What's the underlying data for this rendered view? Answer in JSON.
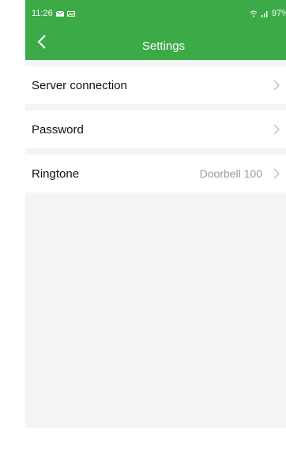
{
  "status_bar": {
    "time": "11:26",
    "icons_left": [
      "mail-icon",
      "gallery-icon"
    ],
    "battery": "97%",
    "icons_right": [
      "wifi-icon",
      "signal-icon"
    ]
  },
  "toolbar": {
    "title": "Settings",
    "back_icon": "chevron-left-icon"
  },
  "settings": [
    {
      "label": "Server connection",
      "value": ""
    },
    {
      "label": "Password",
      "value": ""
    },
    {
      "label": "Ringtone",
      "value": "Doorbell 100"
    }
  ],
  "colors": {
    "header": "#3cab47",
    "background": "#f4f4f4",
    "row": "#ffffff",
    "value_text": "#9a9a9a"
  }
}
